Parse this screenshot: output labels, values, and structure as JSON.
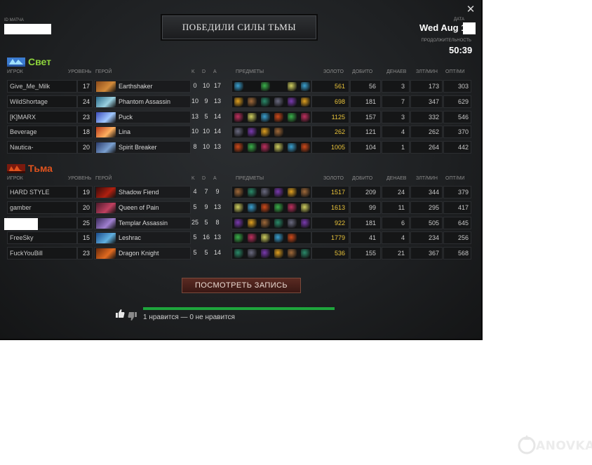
{
  "header": {
    "match_id_label": "ID МАТЧА",
    "result_banner": "ПОБЕДИЛИ СИЛЫ ТЬМЫ",
    "date_label": "ДАТА",
    "date_value": "Wed Aug 1",
    "duration_label": "ПРОДОЛЖИТЕЛЬНОСТЬ",
    "duration_value": "50:39",
    "close_icon": "close-icon"
  },
  "columns": {
    "player": "ИГРОК",
    "level": "УРОВЕНЬ",
    "hero": "ГЕРОЙ",
    "k": "K",
    "d": "D",
    "a": "A",
    "items": "ПРЕДМЕТЫ",
    "gold": "ЗОЛОТО",
    "last_hits": "ДОБИТО",
    "denies": "ДЕНАЕВ",
    "xpm": "ЗЛТ/МИН",
    "gpm": "ОПТ/МИ"
  },
  "radiant": {
    "name": "Свет",
    "color": "#8ed43c",
    "players": [
      {
        "player": "Give_Me_Milk",
        "level": "17",
        "hero": "Earthshaker",
        "k": "0",
        "d": "10",
        "a": "17",
        "gold": "561",
        "lh": "56",
        "dn": "3",
        "xpm": "173",
        "gpm": "303"
      },
      {
        "player": "WildShortage",
        "level": "24",
        "hero": "Phantom Assassin",
        "k": "10",
        "d": "9",
        "a": "13",
        "gold": "698",
        "lh": "181",
        "dn": "7",
        "xpm": "347",
        "gpm": "629"
      },
      {
        "player": "[K]MARX",
        "level": "23",
        "hero": "Puck",
        "k": "13",
        "d": "5",
        "a": "14",
        "gold": "1125",
        "lh": "157",
        "dn": "3",
        "xpm": "332",
        "gpm": "546"
      },
      {
        "player": "Beverage",
        "level": "18",
        "hero": "Lina",
        "k": "10",
        "d": "10",
        "a": "14",
        "gold": "262",
        "lh": "121",
        "dn": "4",
        "xpm": "262",
        "gpm": "370"
      },
      {
        "player": "Nautica-",
        "level": "20",
        "hero": "Spirit Breaker",
        "k": "8",
        "d": "10",
        "a": "13",
        "gold": "1005",
        "lh": "104",
        "dn": "1",
        "xpm": "264",
        "gpm": "442"
      }
    ]
  },
  "dire": {
    "name": "Тьма",
    "color": "#e0531e",
    "players": [
      {
        "player": "HARD STYLE",
        "level": "19",
        "hero": "Shadow Fiend",
        "k": "4",
        "d": "7",
        "a": "9",
        "gold": "1517",
        "lh": "209",
        "dn": "24",
        "xpm": "344",
        "gpm": "379"
      },
      {
        "player": "gamber",
        "level": "20",
        "hero": "Queen of Pain",
        "k": "5",
        "d": "9",
        "a": "13",
        "gold": "1613",
        "lh": "99",
        "dn": "11",
        "xpm": "295",
        "gpm": "417"
      },
      {
        "player": "",
        "level": "25",
        "hero": "Templar Assassin",
        "k": "25",
        "d": "5",
        "a": "8",
        "gold": "922",
        "lh": "181",
        "dn": "6",
        "xpm": "505",
        "gpm": "645"
      },
      {
        "player": "FreeSky",
        "level": "15",
        "hero": "Leshrac",
        "k": "5",
        "d": "16",
        "a": "13",
        "gold": "1779",
        "lh": "41",
        "dn": "4",
        "xpm": "234",
        "gpm": "256"
      },
      {
        "player": "FuckYouBill",
        "level": "23",
        "hero": "Dragon Knight",
        "k": "5",
        "d": "5",
        "a": "14",
        "gold": "536",
        "lh": "155",
        "dn": "21",
        "xpm": "367",
        "gpm": "568"
      }
    ]
  },
  "footer": {
    "replay_button": "ПОСМОТРЕТЬ ЗАПИСЬ",
    "rating_text": "1 нравится — 0 не нравится",
    "like_fraction": 1.0
  },
  "watermark": "ANOVKA"
}
